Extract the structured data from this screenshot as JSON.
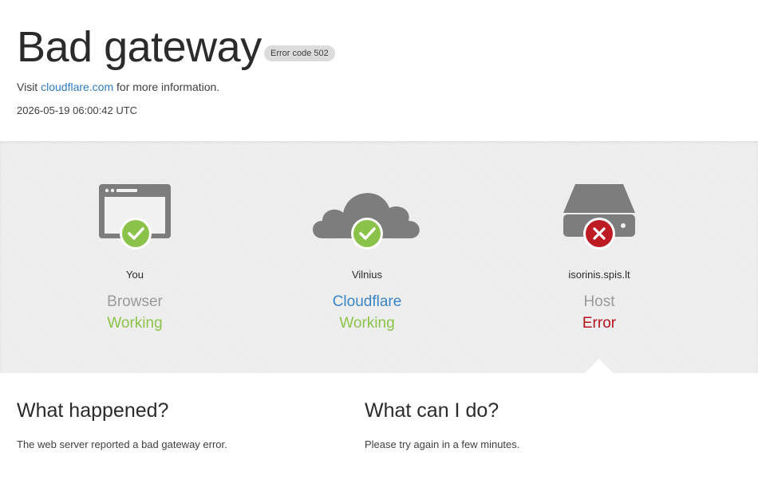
{
  "header": {
    "title": "Bad gateway",
    "error_badge": "Error code 502",
    "visit_prefix": "Visit",
    "visit_link": "cloudflare.com",
    "visit_suffix": "for more information.",
    "timestamp": "2026-05-19 06:00:42 UTC"
  },
  "status": [
    {
      "location": "You",
      "kind": "Browser",
      "state": "Working",
      "icon": "browser-icon",
      "indicator": "check-icon"
    },
    {
      "location": "Vilnius",
      "kind": "Cloudflare",
      "state": "Working",
      "icon": "cloud-icon",
      "indicator": "check-icon"
    },
    {
      "location": "isorinis.spis.lt",
      "kind": "Host",
      "state": "Error",
      "icon": "server-icon",
      "indicator": "x-icon"
    }
  ],
  "colors": {
    "ok": "#8bc34a",
    "error": "#b3141c",
    "link": "#3a85c6",
    "icon_gray": "#7d7d7d"
  },
  "what_happened": {
    "heading": "What happened?",
    "text": "The web server reported a bad gateway error."
  },
  "what_can_i_do": {
    "heading": "What can I do?",
    "text": "Please try again in a few minutes."
  }
}
